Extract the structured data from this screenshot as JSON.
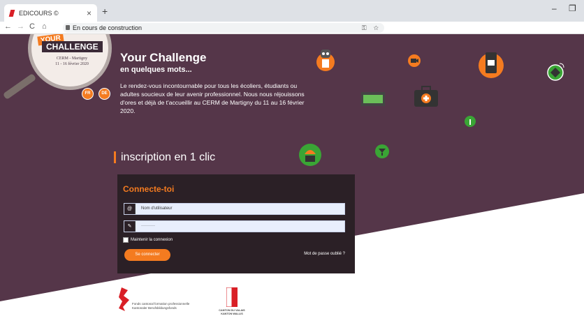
{
  "browser": {
    "tab_title": "EDICOURS ©",
    "tab_close": "×",
    "new_tab": "+",
    "url": "En cours de construction",
    "back": "←",
    "forward": "→",
    "reload": "C",
    "home": "⌂",
    "key_icon": "⚿",
    "star_icon": "☆",
    "minimize": "–",
    "restore": "❐"
  },
  "logo": {
    "your": "YOUR",
    "challenge": "CHALLENGE",
    "location": "CERM - Martigny",
    "dates": "11 - 16 février 2020"
  },
  "header": {
    "title": "Your Challenge",
    "subtitle": "en quelques mots...",
    "intro": "Le rendez-vous incontournable pour tous les écoliers, étudiants ou adultes soucieux de leur avenir professionnel. Nous nous réjouissons d'ores et déjà de t'accueillir au CERM de Martigny du 11 au 16 février 2020."
  },
  "languages": [
    {
      "label": "FR"
    },
    {
      "label": "DE"
    }
  ],
  "inscription_title": "inscription en 1 clic",
  "login": {
    "title": "Connecte-toi",
    "username_placeholder": "Nom d'utilisateur",
    "password_value": "··········",
    "username_icon": "@",
    "password_icon": "🔑",
    "remember_label": "Maintenir la connexion",
    "submit_label": "Se connecter",
    "forgot_label": "Mot de passe oublié ?"
  },
  "sponsors": {
    "fund_line1": "Fonds cantonal formation professionnelle",
    "fund_line2": "Kantonaler Berufsbildungsfonds",
    "canton_line1": "CANTON DU VALAIS",
    "canton_line2": "KANTON WALLIS"
  },
  "colors": {
    "purple": "#553649",
    "orange": "#f47b20",
    "green": "#3aa535",
    "dark": "#2b2026"
  }
}
